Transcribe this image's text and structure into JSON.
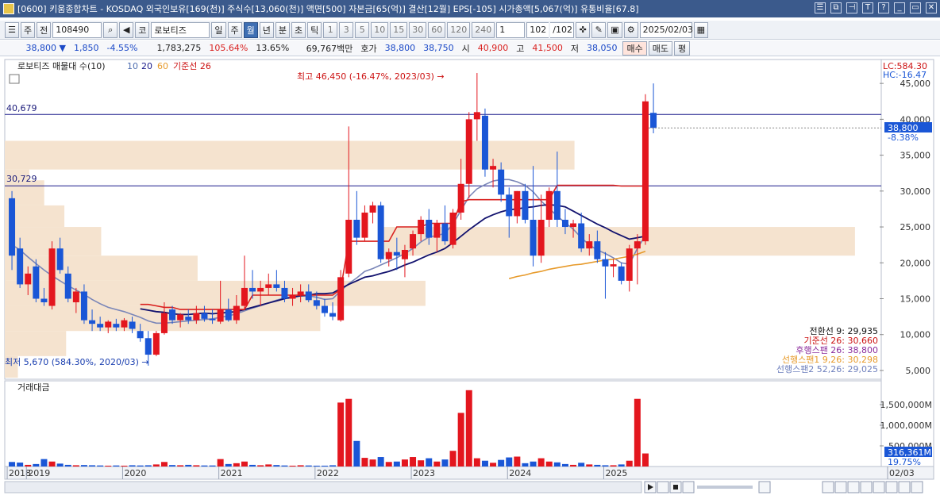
{
  "window": {
    "title": "[0600] 키움종합차트 - KOSDAQ 외국인보유[169(천)] 주식수[13,060(천)] 액면[500] 자본금[65(억)] 결산[12월] EPS[-105] 시가총액[5,067(억)] 유통비율[67.8]",
    "buttons": [
      "☰",
      "⧉",
      "⊣",
      "T",
      "?",
      "_",
      "▭",
      "✕"
    ]
  },
  "toolbar": {
    "menu_glyph": "☰",
    "market_label": "주",
    "prefix_label": "전",
    "code_value": "108490",
    "name_label": "코",
    "name_value": "로보티즈",
    "period_tabs": [
      "일",
      "주",
      "월",
      "년",
      "분",
      "초",
      "틱"
    ],
    "period_active": "월",
    "interval_numbers": [
      "1",
      "3",
      "5",
      "10",
      "15",
      "30",
      "60",
      "120",
      "240"
    ],
    "interval_value": "1",
    "page_value": "102",
    "page_total": "/102",
    "date_value": "2025/02/03"
  },
  "quote": {
    "price": "38,800 ▼",
    "change": "1,850",
    "change_pct": "-4.55%",
    "volume": "1,783,275",
    "vol_ratio": "105.64%",
    "turnover": "13.65%",
    "trade_value": "69,767백만",
    "ask_label": "호가",
    "ask": "38,800",
    "bid": "38,750",
    "open_label": "시",
    "open": "40,900",
    "high_label": "고",
    "high": "41,500",
    "low_label": "저",
    "low": "38,050",
    "sell_btn": "매수",
    "buy_btn": "매도",
    "eval_btn": "평"
  },
  "price_panel": {
    "legend_title": "로보티즈 매물대 수(10)",
    "legend_ma": [
      "10",
      "20",
      "60",
      "기준선 26"
    ],
    "lc_label": "LC:584.30",
    "hc_label": "HC:-16.47",
    "max_annotation": "최고 46,450 (-16.47%, 2023/03) →",
    "min_annotation": "최저 5,670 (584.30%, 2020/03) →",
    "hline1_label": "40,679",
    "hline2_label": "30,729",
    "current_price_tag": "38,800",
    "current_pct_tag": "-8.38%",
    "yticks": [
      "45,000",
      "40,000",
      "35,000",
      "30,000",
      "25,000",
      "20,000",
      "15,000",
      "10,000",
      "5,000"
    ],
    "ichimoku": [
      {
        "text": "전환선 9: 29,935",
        "color": "#111111"
      },
      {
        "text": "기준선 26: 30,660",
        "color": "#cc1111"
      },
      {
        "text": "후행스팬 26: 38,800",
        "color": "#8a2a9b"
      },
      {
        "text": "선행스팬1 9,26: 30,298",
        "color": "#e79a2a"
      },
      {
        "text": "선행스팬2 52,26: 29,025",
        "color": "#6d7fbd"
      }
    ]
  },
  "volume_panel": {
    "title": "거래대금",
    "yticks": [
      "1,500,000M",
      "1,000,000M",
      "500,000M"
    ],
    "current_tag": "316,361M",
    "current_pct": "19.75%"
  },
  "xaxis": {
    "labels": [
      "2018",
      "2019",
      "2020",
      "2021",
      "2022",
      "2023",
      "2024",
      "2025",
      "02/03"
    ]
  },
  "colors": {
    "up": "#e3161e",
    "down": "#1a56d6",
    "volume_profile": "#f5e3cf",
    "titlebar": "#3b5a8c"
  },
  "chart_data": {
    "type": "candlestick",
    "interval": "monthly",
    "ylim": [
      4000,
      48000
    ],
    "period": "2018/11 - 2025/02",
    "candles": [
      {
        "o": 29000,
        "h": 30000,
        "l": 19000,
        "c": 21000
      },
      {
        "o": 22000,
        "h": 23500,
        "l": 16500,
        "c": 17000
      },
      {
        "o": 17000,
        "h": 19500,
        "l": 15500,
        "c": 18500
      },
      {
        "o": 19500,
        "h": 20500,
        "l": 14500,
        "c": 15000
      },
      {
        "o": 15000,
        "h": 16500,
        "l": 14000,
        "c": 14500
      },
      {
        "o": 14000,
        "h": 23000,
        "l": 13500,
        "c": 22000
      },
      {
        "o": 22000,
        "h": 23500,
        "l": 18500,
        "c": 19000
      },
      {
        "o": 18500,
        "h": 19500,
        "l": 14500,
        "c": 15000
      },
      {
        "o": 14500,
        "h": 16500,
        "l": 13000,
        "c": 16000
      },
      {
        "o": 16000,
        "h": 17000,
        "l": 11500,
        "c": 12000
      },
      {
        "o": 12000,
        "h": 13500,
        "l": 10500,
        "c": 11500
      },
      {
        "o": 11500,
        "h": 12500,
        "l": 10500,
        "c": 11000
      },
      {
        "o": 11000,
        "h": 12000,
        "l": 10200,
        "c": 11800
      },
      {
        "o": 11500,
        "h": 12200,
        "l": 10500,
        "c": 11000
      },
      {
        "o": 11000,
        "h": 12300,
        "l": 10500,
        "c": 12000
      },
      {
        "o": 11800,
        "h": 12500,
        "l": 10200,
        "c": 10800
      },
      {
        "o": 10500,
        "h": 11500,
        "l": 9000,
        "c": 9500
      },
      {
        "o": 9500,
        "h": 10500,
        "l": 5670,
        "c": 7200
      },
      {
        "o": 7200,
        "h": 10500,
        "l": 7000,
        "c": 10200
      },
      {
        "o": 10200,
        "h": 14500,
        "l": 10000,
        "c": 13000
      },
      {
        "o": 13500,
        "h": 14000,
        "l": 11500,
        "c": 12000
      },
      {
        "o": 12000,
        "h": 13000,
        "l": 11000,
        "c": 12800
      },
      {
        "o": 12500,
        "h": 13500,
        "l": 11500,
        "c": 12000
      },
      {
        "o": 12000,
        "h": 14000,
        "l": 11500,
        "c": 13000
      },
      {
        "o": 13000,
        "h": 14000,
        "l": 11800,
        "c": 12200
      },
      {
        "o": 12200,
        "h": 13500,
        "l": 11500,
        "c": 12000
      },
      {
        "o": 11800,
        "h": 17500,
        "l": 11500,
        "c": 13500
      },
      {
        "o": 13500,
        "h": 15000,
        "l": 11800,
        "c": 12000
      },
      {
        "o": 12000,
        "h": 15500,
        "l": 11500,
        "c": 14000
      },
      {
        "o": 14000,
        "h": 21000,
        "l": 13500,
        "c": 16500
      },
      {
        "o": 16500,
        "h": 19000,
        "l": 15000,
        "c": 16000
      },
      {
        "o": 16000,
        "h": 17500,
        "l": 14000,
        "c": 16500
      },
      {
        "o": 16500,
        "h": 18500,
        "l": 15500,
        "c": 17000
      },
      {
        "o": 17000,
        "h": 19000,
        "l": 16000,
        "c": 16500
      },
      {
        "o": 16500,
        "h": 17500,
        "l": 14500,
        "c": 15000
      },
      {
        "o": 15000,
        "h": 16500,
        "l": 14000,
        "c": 15500
      },
      {
        "o": 15500,
        "h": 17000,
        "l": 14500,
        "c": 16000
      },
      {
        "o": 16000,
        "h": 17000,
        "l": 14500,
        "c": 14800
      },
      {
        "o": 14800,
        "h": 16000,
        "l": 13500,
        "c": 14000
      },
      {
        "o": 14000,
        "h": 15000,
        "l": 12500,
        "c": 13000
      },
      {
        "o": 13000,
        "h": 14500,
        "l": 12000,
        "c": 12500
      },
      {
        "o": 12000,
        "h": 19000,
        "l": 11800,
        "c": 18000
      },
      {
        "o": 18500,
        "h": 39000,
        "l": 18000,
        "c": 26000
      },
      {
        "o": 26000,
        "h": 30000,
        "l": 22500,
        "c": 23500
      },
      {
        "o": 23500,
        "h": 28000,
        "l": 23000,
        "c": 27000
      },
      {
        "o": 27000,
        "h": 28500,
        "l": 25500,
        "c": 28000
      },
      {
        "o": 28000,
        "h": 28500,
        "l": 20000,
        "c": 20500
      },
      {
        "o": 20500,
        "h": 22000,
        "l": 19500,
        "c": 21500
      },
      {
        "o": 21500,
        "h": 23500,
        "l": 19000,
        "c": 21000
      },
      {
        "o": 20500,
        "h": 22500,
        "l": 18000,
        "c": 21800
      },
      {
        "o": 22000,
        "h": 24500,
        "l": 21000,
        "c": 24000
      },
      {
        "o": 24000,
        "h": 26500,
        "l": 23000,
        "c": 26000
      },
      {
        "o": 26000,
        "h": 27500,
        "l": 22500,
        "c": 23500
      },
      {
        "o": 23500,
        "h": 26000,
        "l": 21500,
        "c": 25500
      },
      {
        "o": 25500,
        "h": 28000,
        "l": 22500,
        "c": 23000
      },
      {
        "o": 22500,
        "h": 27500,
        "l": 22000,
        "c": 27000
      },
      {
        "o": 27000,
        "h": 34500,
        "l": 26000,
        "c": 31000
      },
      {
        "o": 31000,
        "h": 41000,
        "l": 29000,
        "c": 40000
      },
      {
        "o": 40000,
        "h": 46450,
        "l": 37000,
        "c": 41000
      },
      {
        "o": 40500,
        "h": 41500,
        "l": 32000,
        "c": 33000
      },
      {
        "o": 33000,
        "h": 34500,
        "l": 30500,
        "c": 33500
      },
      {
        "o": 33000,
        "h": 34000,
        "l": 28500,
        "c": 29500
      },
      {
        "o": 29500,
        "h": 30500,
        "l": 23500,
        "c": 26500
      },
      {
        "o": 26500,
        "h": 30000,
        "l": 25500,
        "c": 30000
      },
      {
        "o": 30000,
        "h": 31000,
        "l": 25500,
        "c": 26000
      },
      {
        "o": 26000,
        "h": 33500,
        "l": 19500,
        "c": 21000
      },
      {
        "o": 21000,
        "h": 29500,
        "l": 20000,
        "c": 26000
      },
      {
        "o": 26000,
        "h": 30500,
        "l": 25000,
        "c": 30000
      },
      {
        "o": 30000,
        "h": 35500,
        "l": 25000,
        "c": 26000
      },
      {
        "o": 26000,
        "h": 27500,
        "l": 24000,
        "c": 25000
      },
      {
        "o": 25000,
        "h": 26000,
        "l": 23500,
        "c": 25500
      },
      {
        "o": 25500,
        "h": 27000,
        "l": 21500,
        "c": 22000
      },
      {
        "o": 22000,
        "h": 24000,
        "l": 21000,
        "c": 23000
      },
      {
        "o": 23000,
        "h": 24500,
        "l": 20000,
        "c": 20500
      },
      {
        "o": 20500,
        "h": 21500,
        "l": 15000,
        "c": 19500
      },
      {
        "o": 19500,
        "h": 20500,
        "l": 18000,
        "c": 19800
      },
      {
        "o": 19500,
        "h": 20000,
        "l": 17000,
        "c": 17500
      },
      {
        "o": 17500,
        "h": 22500,
        "l": 16000,
        "c": 22000
      },
      {
        "o": 22000,
        "h": 24000,
        "l": 17000,
        "c": 23000
      },
      {
        "o": 23000,
        "h": 43500,
        "l": 22500,
        "c": 42500
      },
      {
        "o": 40900,
        "h": 45000,
        "l": 38050,
        "c": 38800
      }
    ],
    "volume_m": [
      110000,
      95000,
      40000,
      60000,
      180000,
      120000,
      70000,
      40000,
      30000,
      35000,
      30000,
      25000,
      20000,
      25000,
      20000,
      30000,
      25000,
      30000,
      50000,
      110000,
      35000,
      30000,
      40000,
      30000,
      25000,
      25000,
      180000,
      60000,
      80000,
      120000,
      40000,
      30000,
      50000,
      35000,
      25000,
      20000,
      30000,
      25000,
      20000,
      20000,
      30000,
      1550000,
      1640000,
      620000,
      210000,
      170000,
      230000,
      110000,
      120000,
      170000,
      230000,
      150000,
      200000,
      120000,
      170000,
      380000,
      1300000,
      1850000,
      200000,
      140000,
      90000,
      160000,
      220000,
      240000,
      80000,
      120000,
      200000,
      120000,
      100000,
      60000,
      40000,
      90000,
      50000,
      40000,
      30000,
      30000,
      50000,
      140000,
      1640000,
      316361
    ],
    "ma10": [
      22500,
      21800,
      20800,
      19900,
      19000,
      18200,
      17500,
      16800,
      16200,
      15600,
      14900,
      14300,
      13800,
      13500,
      13200,
      12800,
      12400,
      11900,
      11600,
      11600,
      11700,
      11800,
      11900,
      12000,
      12100,
      12200,
      12400,
      12600,
      12900,
      13300,
      13700,
      14000,
      14400,
      14800,
      15100,
      15300,
      15400,
      15400,
      15200,
      14900,
      15000,
      16100,
      17100,
      17900,
      18800,
      19200,
      19700,
      20200,
      20700,
      21300,
      22000,
      22900,
      23600,
      23800,
      24100,
      25400,
      27300,
      29200,
      30300,
      30900,
      31400,
      31600,
      31600,
      31300,
      30800,
      29900,
      28600,
      27600,
      26500,
      25600,
      24700,
      23500,
      22500,
      21800,
      21300,
      20700,
      20000,
      19800,
      22000,
      23800
    ],
    "ma20": [
      null,
      null,
      null,
      null,
      null,
      null,
      null,
      null,
      null,
      null,
      null,
      null,
      null,
      null,
      null,
      null,
      13600,
      13400,
      13200,
      13100,
      12900,
      12800,
      12800,
      12900,
      13000,
      12900,
      13000,
      13100,
      13200,
      13500,
      13800,
      14100,
      14400,
      14700,
      15000,
      15200,
      15400,
      15500,
      15700,
      15700,
      15800,
      16400,
      17000,
      17500,
      18000,
      18200,
      18500,
      18800,
      19200,
      19700,
      20100,
      20600,
      21100,
      21500,
      22000,
      22800,
      23700,
      24600,
      25400,
      26200,
      26700,
      27100,
      27400,
      27500,
      27700,
      27800,
      28000,
      28100,
      28000,
      27800,
      27200,
      26600,
      26000,
      25400,
      24900,
      24300,
      23800,
      23300,
      23500,
      23700
    ],
    "ma60": [
      null,
      null,
      null,
      null,
      null,
      null,
      null,
      null,
      null,
      null,
      null,
      null,
      null,
      null,
      null,
      null,
      null,
      null,
      null,
      null,
      null,
      null,
      null,
      null,
      null,
      null,
      null,
      null,
      null,
      null,
      null,
      null,
      null,
      null,
      null,
      null,
      null,
      null,
      null,
      null,
      null,
      null,
      null,
      null,
      null,
      null,
      null,
      null,
      null,
      null,
      null,
      null,
      null,
      null,
      null,
      null,
      null,
      null,
      null,
      null,
      null,
      null,
      17800,
      18100,
      18300,
      18600,
      18800,
      19100,
      19300,
      19500,
      19700,
      19800,
      20000,
      20200,
      20400,
      20500,
      20700,
      20900,
      21200,
      21600
    ],
    "kijun26": [
      null,
      null,
      null,
      null,
      null,
      null,
      null,
      null,
      null,
      null,
      null,
      null,
      null,
      null,
      null,
      null,
      14200,
      14200,
      14000,
      13800,
      13800,
      13500,
      13500,
      13500,
      13500,
      13500,
      13500,
      13500,
      13500,
      13500,
      15500,
      15500,
      15500,
      15500,
      15500,
      15500,
      15500,
      15500,
      15500,
      15500,
      15500,
      16300,
      23000,
      23000,
      23000,
      23000,
      23000,
      23000,
      25000,
      25000,
      25000,
      25000,
      25500,
      25500,
      25500,
      25500,
      28500,
      28800,
      28800,
      28800,
      28800,
      28800,
      28800,
      28800,
      28800,
      28800,
      28800,
      28800,
      30800,
      30800,
      30800,
      30800,
      30800,
      30800,
      30800,
      30800,
      30700,
      30700,
      30700,
      30700
    ],
    "profile": [
      {
        "lo": 33000,
        "hi": 37000,
        "len": 0.65
      },
      {
        "lo": 31500,
        "hi": 33000,
        "len": 0.028
      },
      {
        "lo": 28000,
        "hi": 31500,
        "len": 0.045
      },
      {
        "lo": 25000,
        "hi": 28000,
        "len": 0.068
      },
      {
        "lo": 21000,
        "hi": 25000,
        "len": 0.11
      },
      {
        "lo": 17500,
        "hi": 21000,
        "len": 0.22
      },
      {
        "lo": 14000,
        "hi": 17500,
        "len": 0.48
      },
      {
        "lo": 10500,
        "hi": 14000,
        "len": 0.36
      },
      {
        "lo": 7000,
        "hi": 10500,
        "len": 0.07
      },
      {
        "lo": 4000,
        "hi": 7000,
        "len": 0.015
      }
    ],
    "lookback_bands": [
      {
        "lo": 21000,
        "hi": 25000,
        "len": 0.97
      }
    ],
    "hlines": [
      40679,
      30729
    ]
  }
}
